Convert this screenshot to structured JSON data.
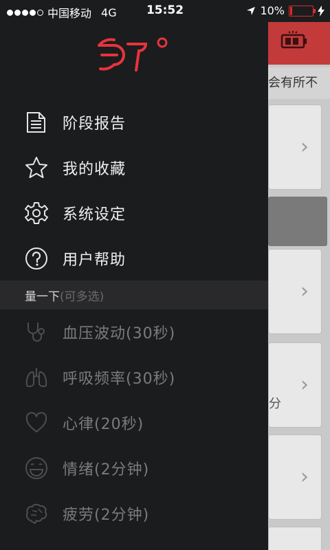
{
  "status_bar": {
    "carrier": "中国移动",
    "network": "4G",
    "time": "15:52",
    "battery": "10%",
    "signal_bars": 4,
    "battery_level": 0.1
  },
  "drawer": {
    "logo_text": "37°",
    "menu": [
      {
        "label": "阶段报告",
        "icon": "document-icon"
      },
      {
        "label": "我的收藏",
        "icon": "star-icon"
      },
      {
        "label": "系统设定",
        "icon": "gear-icon"
      },
      {
        "label": "用户帮助",
        "icon": "help-icon"
      }
    ],
    "section": {
      "title": "量一下",
      "subtitle": "(可多选)"
    },
    "measurements": [
      {
        "label": "血压波动(30秒)",
        "icon": "stethoscope-icon"
      },
      {
        "label": "呼吸频率(30秒)",
        "icon": "lungs-icon"
      },
      {
        "label": "心律(20秒)",
        "icon": "heart-icon"
      },
      {
        "label": "情绪(2分钟)",
        "icon": "smile-icon"
      },
      {
        "label": "疲劳(2分钟)",
        "icon": "brain-icon"
      }
    ]
  },
  "background": {
    "banner_text": "会有所不",
    "fragment_text": "分"
  },
  "colors": {
    "accent": "#e8343c",
    "drawer_bg": "#1b1c1e",
    "section_bg": "#29292b",
    "disabled_text": "#7b7b7d"
  }
}
